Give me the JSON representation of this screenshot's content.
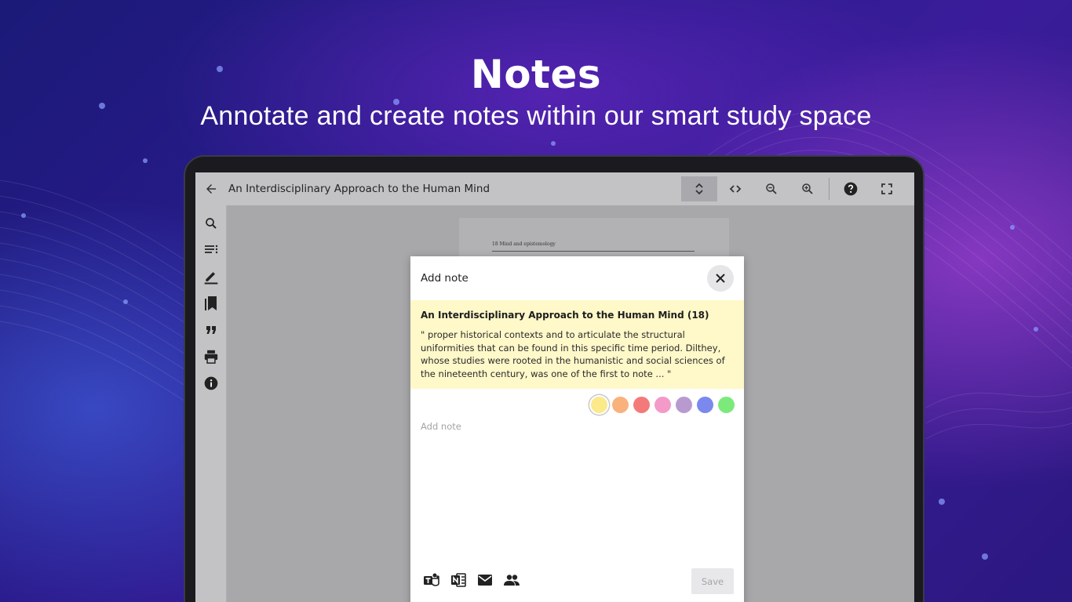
{
  "hero": {
    "title": "Notes",
    "subtitle": "Annotate and create notes within our smart study space"
  },
  "reader": {
    "doc_title": "An Interdisciplinary Approach to the Human Mind",
    "toolbar": [
      "scroll-vertical-icon",
      "scroll-horizontal-icon",
      "zoom-out-icon",
      "zoom-in-icon",
      "help-icon",
      "fullscreen-icon"
    ],
    "sidebar": [
      "search-icon",
      "contents-icon",
      "highlight-icon",
      "bookmarks-icon",
      "quote-icon",
      "print-icon",
      "info-icon"
    ],
    "page_header": "18    Mind and epistemology"
  },
  "modal": {
    "title": "Add note",
    "quote_source": "An Interdisciplinary Approach to the Human Mind (18)",
    "quote_text": "\" proper historical contexts and to articulate the structural uniformities that can be found in this specific time period. Dilthey, whose studies were rooted in the humanistic and social sciences of the nineteenth century, was one of the first to note ... \"",
    "note_placeholder": "Add note",
    "save_label": "Save",
    "colors": [
      "#fbe98a",
      "#f9b27c",
      "#f47a7a",
      "#f39ac9",
      "#b99ad0",
      "#7b88ee",
      "#7bea7b"
    ],
    "selected_color_index": 0,
    "share": [
      "teams-icon",
      "onenote-icon",
      "email-icon",
      "people-icon"
    ]
  }
}
